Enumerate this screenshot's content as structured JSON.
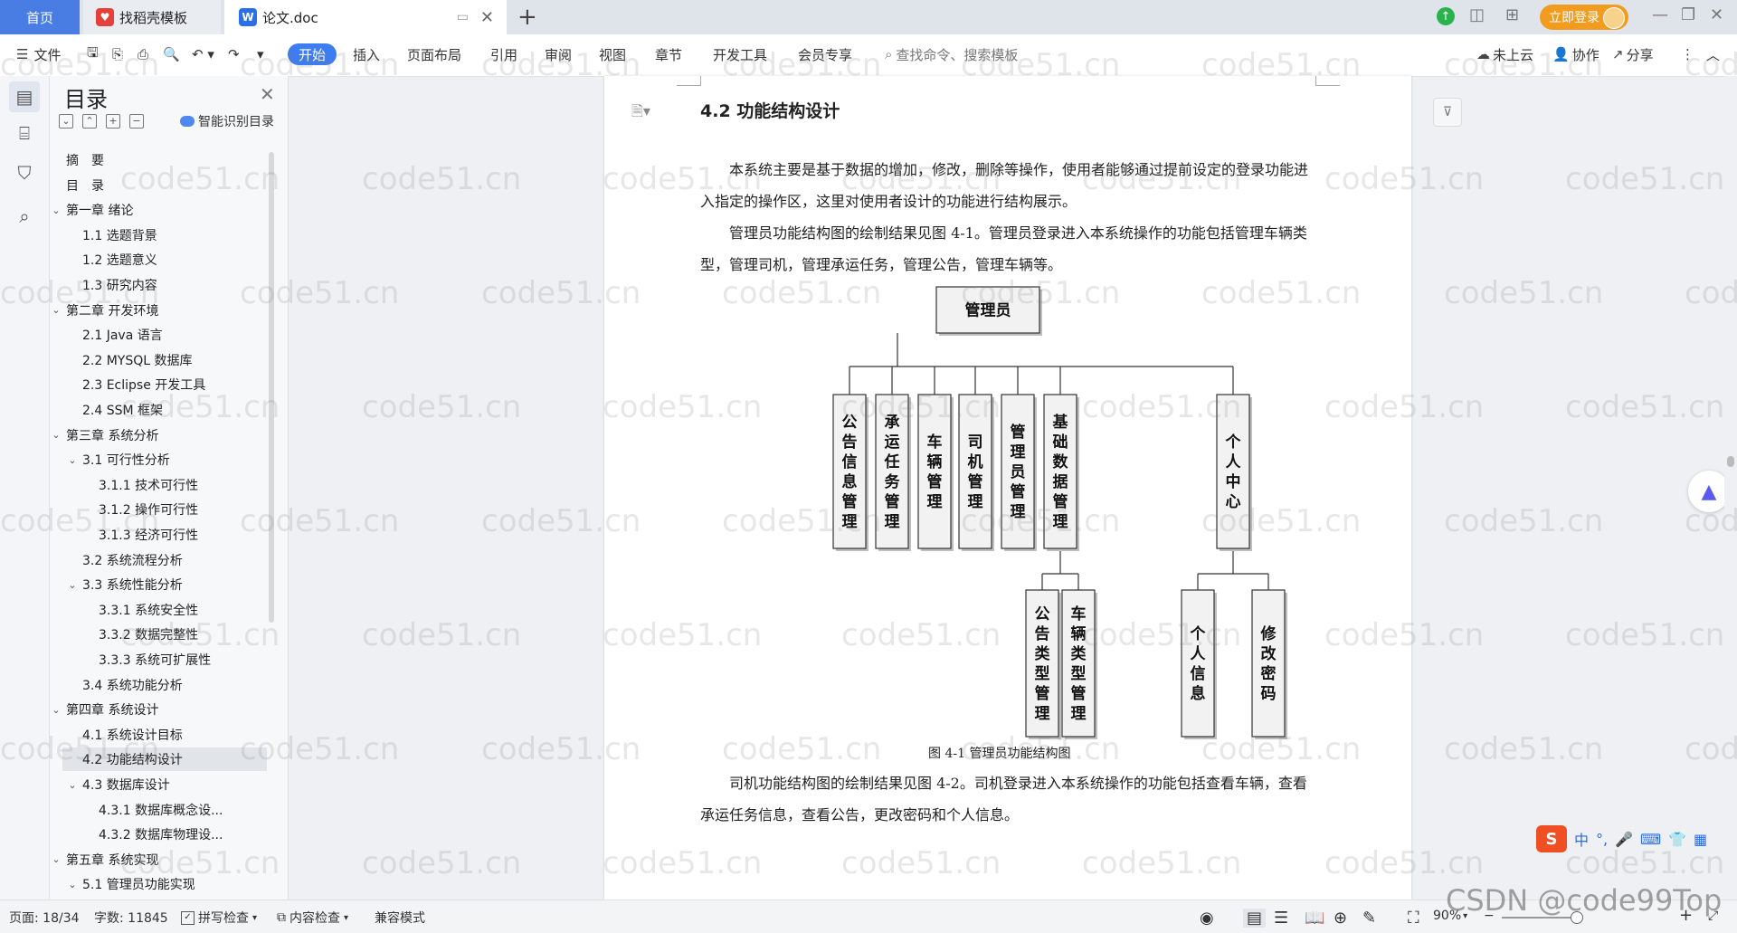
{
  "tabs": {
    "home": "首页",
    "templates": "找稻壳模板",
    "doc": "论文.doc",
    "login": "立即登录"
  },
  "ribbon": {
    "file": "文件",
    "items": [
      "开始",
      "插入",
      "页面布局",
      "引用",
      "审阅",
      "视图",
      "章节",
      "开发工具",
      "会员专享"
    ],
    "search_placeholder": "查找命令、搜索模板",
    "cloud": "未上云",
    "collab": "协作",
    "share": "分享"
  },
  "toc": {
    "title": "目录",
    "smart": "智能识别目录",
    "items": [
      {
        "label": "摘　要",
        "level": 0,
        "caret": ""
      },
      {
        "label": "目　录",
        "level": 0,
        "caret": ""
      },
      {
        "label": "第一章  绪论",
        "level": 0,
        "caret": "v"
      },
      {
        "label": "1.1  选题背景",
        "level": 1,
        "caret": ""
      },
      {
        "label": "1.2  选题意义",
        "level": 1,
        "caret": ""
      },
      {
        "label": "1.3  研究内容",
        "level": 1,
        "caret": ""
      },
      {
        "label": "第二章  开发环境",
        "level": 0,
        "caret": "v"
      },
      {
        "label": "2.1 Java 语言",
        "level": 1,
        "caret": ""
      },
      {
        "label": "2.2 MYSQL 数据库",
        "level": 1,
        "caret": ""
      },
      {
        "label": "2.3 Eclipse 开发工具",
        "level": 1,
        "caret": ""
      },
      {
        "label": "2.4 SSM 框架",
        "level": 1,
        "caret": ""
      },
      {
        "label": "第三章  系统分析",
        "level": 0,
        "caret": "v"
      },
      {
        "label": "3.1 可行性分析",
        "level": 1,
        "caret": "v"
      },
      {
        "label": "3.1.1 技术可行性",
        "level": 2,
        "caret": ""
      },
      {
        "label": "3.1.2 操作可行性",
        "level": 2,
        "caret": ""
      },
      {
        "label": "3.1.3 经济可行性",
        "level": 2,
        "caret": ""
      },
      {
        "label": "3.2 系统流程分析",
        "level": 1,
        "caret": ""
      },
      {
        "label": "3.3 系统性能分析",
        "level": 1,
        "caret": "v"
      },
      {
        "label": "3.3.1 系统安全性",
        "level": 2,
        "caret": ""
      },
      {
        "label": "3.3.2 数据完整性",
        "level": 2,
        "caret": ""
      },
      {
        "label": "3.3.3 系统可扩展性",
        "level": 2,
        "caret": ""
      },
      {
        "label": "3.4 系统功能分析",
        "level": 1,
        "caret": ""
      },
      {
        "label": "第四章  系统设计",
        "level": 0,
        "caret": "v"
      },
      {
        "label": "4.1  系统设计目标",
        "level": 1,
        "caret": ""
      },
      {
        "label": "4.2 功能结构设计",
        "level": 1,
        "caret": "",
        "selected": true
      },
      {
        "label": "4.3 数据库设计",
        "level": 1,
        "caret": "v"
      },
      {
        "label": "4.3.1  数据库概念设...",
        "level": 2,
        "caret": ""
      },
      {
        "label": "4.3.2  数据库物理设...",
        "level": 2,
        "caret": ""
      },
      {
        "label": "第五章  系统实现",
        "level": 0,
        "caret": "v"
      },
      {
        "label": "5.1 管理员功能实现",
        "level": 1,
        "caret": "v"
      }
    ]
  },
  "doc": {
    "heading": "4.2 功能结构设计",
    "para1": "本系统主要是基于数据的增加，修改，删除等操作，使用者能够通过提前设定的登录功能进入指定的操作区，这里对使用者设计的功能进行结构展示。",
    "para2": "管理员功能结构图的绘制结果见图 4-1。管理员登录进入本系统操作的功能包括管理车辆类型，管理司机，管理承运任务，管理公告，管理车辆等。",
    "caption": "图 4-1  管理员功能结构图",
    "para3": "司机功能结构图的绘制结果见图 4-2。司机登录进入本系统操作的功能包括查看车辆，查看承运任务信息，查看公告，更改密码和个人信息。",
    "diagram": {
      "root": "管理员",
      "children": [
        "公告信息管理",
        "承运任务管理",
        "车辆管理",
        "司机管理",
        "管理员管理",
        "基础数据管理",
        "个人中心"
      ],
      "sub_basic": [
        "公告类型管理",
        "车辆类型管理"
      ],
      "sub_personal": [
        "个人信息",
        "修改密码"
      ]
    }
  },
  "status": {
    "page": "页面: 18/34",
    "words": "字数: 11845",
    "spell": "拼写检查",
    "content": "内容检查",
    "compat": "兼容模式",
    "zoom": "90%"
  },
  "ime": {
    "lang": "中"
  },
  "watermark": "code51.cn",
  "csdn": "CSDN @code99Top",
  "colors": {
    "accent": "#3e7df1",
    "login": "#f29c1f",
    "home_tab": "#4a7de3"
  }
}
